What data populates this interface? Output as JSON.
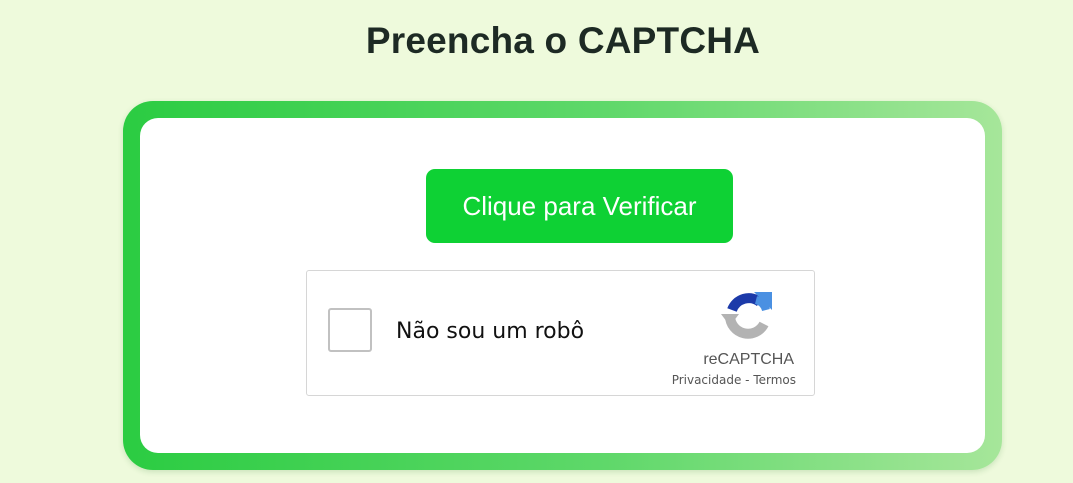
{
  "page": {
    "title": "Preencha o CAPTCHA"
  },
  "verify_button": {
    "label": "Clique para Verificar"
  },
  "recaptcha": {
    "checkbox_label": "Não sou um robô",
    "brand": "reCAPTCHA",
    "privacy_link": "Privacidade",
    "separator": " - ",
    "terms_link": "Termos",
    "icon": "recaptcha-logo-icon"
  },
  "colors": {
    "background": "#eefadc",
    "button": "#0ed134",
    "frame_start": "#2bcc42",
    "frame_end": "#a6e69a",
    "logo_blue_dark": "#1c3aa9",
    "logo_blue_light": "#4a90e2",
    "logo_gray": "#b3b3b3"
  }
}
